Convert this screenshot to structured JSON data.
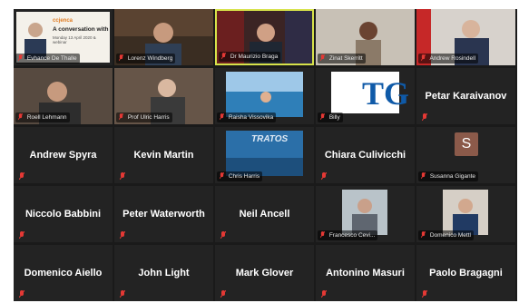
{
  "meeting": {
    "tiles": [
      {
        "id": "t1",
        "label": "Evhance De Thalle",
        "kind": "slide"
      },
      {
        "id": "t2",
        "label": "Lorenz Windberg",
        "kind": "video"
      },
      {
        "id": "t3",
        "label": "Dr Maurizio Braga",
        "kind": "video",
        "active": true
      },
      {
        "id": "t4",
        "label": "Zinat Skerritt",
        "kind": "video"
      },
      {
        "id": "t5",
        "label": "Andrew Rosindell",
        "kind": "video"
      },
      {
        "id": "t6",
        "label": "Roell Lehmann",
        "kind": "video"
      },
      {
        "id": "t7",
        "label": "Prof Ulric Harris",
        "kind": "video"
      },
      {
        "id": "t8",
        "label": "Raisha Vissovika",
        "kind": "image"
      },
      {
        "id": "t9",
        "label": "Billy",
        "kind": "image"
      },
      {
        "id": "t10",
        "name": "Petar Karaivanov",
        "kind": "name"
      },
      {
        "id": "t11",
        "name": "Andrew Spyra",
        "kind": "name"
      },
      {
        "id": "t12",
        "name": "Kevin Martin",
        "kind": "name"
      },
      {
        "id": "t13",
        "label": "Chris Harris",
        "kind": "image"
      },
      {
        "id": "t14",
        "name": "Chiara Culivicchi",
        "kind": "name"
      },
      {
        "id": "t15",
        "label": "Susanna Gigante",
        "kind": "avatar",
        "initial": "S"
      },
      {
        "id": "t16",
        "name": "Niccolo Babbini",
        "kind": "name"
      },
      {
        "id": "t17",
        "name": "Peter Waterworth",
        "kind": "name"
      },
      {
        "id": "t18",
        "name": "Neil Ancell",
        "kind": "name"
      },
      {
        "id": "t19",
        "label": "Francesco Cevi...",
        "kind": "image"
      },
      {
        "id": "t20",
        "label": "Domenico Mettl",
        "kind": "image"
      },
      {
        "id": "t21",
        "name": "Domenico Aiello",
        "kind": "name"
      },
      {
        "id": "t22",
        "name": "John Light",
        "kind": "name"
      },
      {
        "id": "t23",
        "name": "Mark Glover",
        "kind": "name"
      },
      {
        "id": "t24",
        "name": "Antonino Masuri",
        "kind": "name"
      },
      {
        "id": "t25",
        "name": "Paolo Bragagni",
        "kind": "name"
      }
    ],
    "slide": {
      "brand": "ccjenca",
      "headline": "A conversation with",
      "subtitle": "Monday 13 April 2020 & webinar"
    },
    "brand_logo": "TG",
    "banner_text": "TRATOS",
    "colors": {
      "active_border": "#d7e24a",
      "muted_mic": "#e53935",
      "tile_bg": "#232323",
      "grid_bg": "#1a1a1a"
    }
  }
}
